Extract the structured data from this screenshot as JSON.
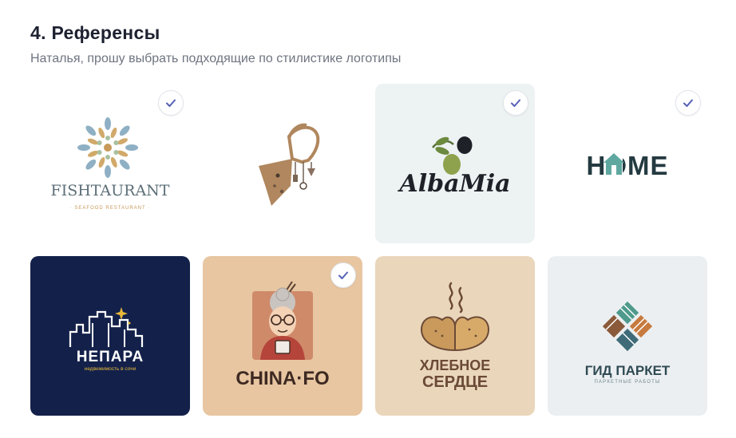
{
  "section": {
    "title": "4.  Референсы",
    "subtitle": "Наталья, прошу выбрать подходящие по стилистике логотипы"
  },
  "colors": {
    "check_accent": "#5561b5",
    "navy": "#13214a",
    "peach": "#e7c6a1",
    "cream": "#ead6bb",
    "light_gray": "#eceff1",
    "mint_gray": "#edf2f3"
  },
  "references": [
    {
      "brand": "FISHTAURANT",
      "tagline": "· SEAFOOD RESTAURANT ·",
      "background": "#ffffff",
      "selected": true
    },
    {
      "brand": "",
      "tagline": "",
      "background": "#ffffff",
      "selected": false
    },
    {
      "brand": "AlbaMia",
      "tagline": "",
      "background": "#edf2f3",
      "selected": true
    },
    {
      "brand": "HOME",
      "tagline": "",
      "background": "#ffffff",
      "selected": true
    },
    {
      "brand": "НЕПАРА",
      "tagline": "недвижимость в сочи",
      "background": "#13214a",
      "selected": false
    },
    {
      "brand": "CHINA·FO",
      "tagline": "",
      "background": "#e7c6a1",
      "selected": true
    },
    {
      "brand": "ХЛЕБНОЕ",
      "brand_line2": "СЕРДЦЕ",
      "tagline": "",
      "background": "#ead6bb",
      "selected": false
    },
    {
      "brand": "ГИД ПАРКЕТ",
      "tagline": "ПАРКЕТНЫЕ РАБОТЫ",
      "background": "#eceff1",
      "selected": false
    }
  ]
}
